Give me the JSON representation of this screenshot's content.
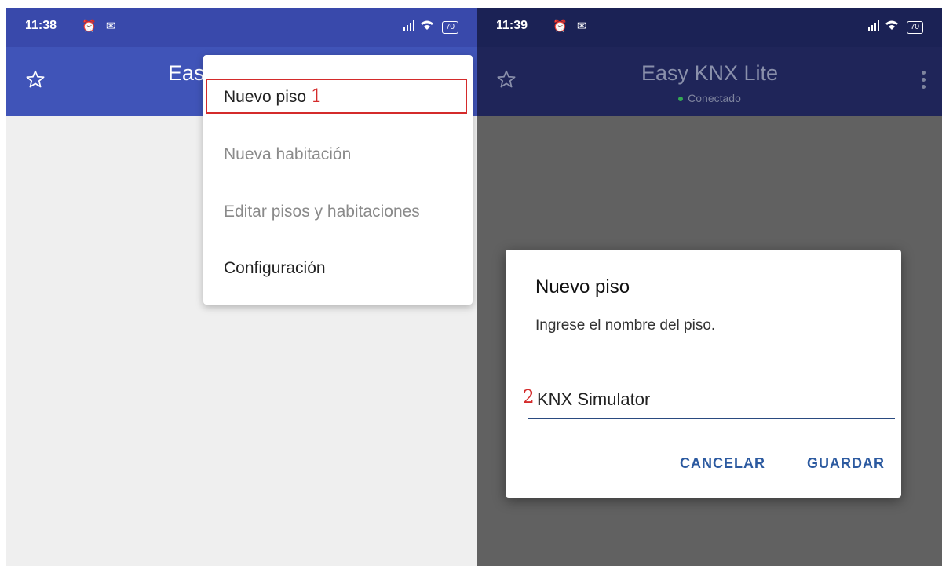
{
  "left": {
    "status": {
      "time": "11:38",
      "icons": "⏰ ✉",
      "battery": "70"
    },
    "appbar": {
      "title": "Eas"
    },
    "menu": {
      "items": [
        {
          "label": "Nuevo piso",
          "enabled": true
        },
        {
          "label": "Nueva habitación",
          "enabled": false
        },
        {
          "label": "Editar pisos y habitaciones",
          "enabled": false
        },
        {
          "label": "Configuración",
          "enabled": true
        }
      ],
      "annotation": "1"
    }
  },
  "right": {
    "status": {
      "time": "11:39",
      "icons": "⏰ ✉",
      "battery": "70"
    },
    "appbar": {
      "title": "Easy KNX Lite",
      "subtitle": "Conectado"
    },
    "dialog": {
      "title": "Nuevo piso",
      "message": "Ingrese el nombre del piso.",
      "field_value": "KNX Simulator",
      "annotation": "2",
      "cancel_label": "CANCELAR",
      "save_label": "GUARDAR"
    }
  },
  "colors": {
    "appbar_left": "#4054b8",
    "appbar_right_dimmed": "#1f2559",
    "accent": "#2c5aa0",
    "annotation_red": "#d42b2b",
    "connected_green": "#34a853"
  },
  "icons": [
    "star-icon",
    "alarm-icon",
    "mail-icon",
    "signal-icon",
    "wifi-icon",
    "battery-icon",
    "more-vert-icon"
  ]
}
